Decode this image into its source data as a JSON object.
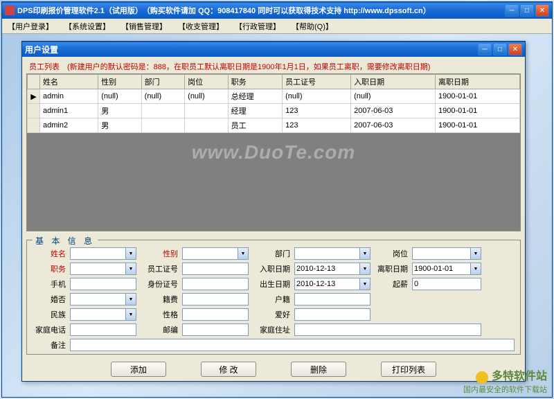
{
  "outer": {
    "title": "DPS印刷报价管理软件2.1（试用版）　（购买软件请加 QQ：908417840 同时可以获取得技术支持 http://www.dpssoft.cn）"
  },
  "menu": [
    "【用户登录】",
    "【系统设置】",
    "【销售管理】",
    "【收支管理】",
    "【行政管理】",
    "【帮助(Q)】"
  ],
  "inner": {
    "title": "用户设置"
  },
  "hint": "员工列表　(新建用户的默认密码是：888，在职员工默认离职日期是1900年1月1日，如果员工离职，需要修改离职日期)",
  "headers": [
    "",
    "姓名",
    "性别",
    "部门",
    "岗位",
    "职务",
    "员工证号",
    "入职日期",
    "离职日期"
  ],
  "rows": [
    {
      "mark": "▶",
      "name": "admin",
      "sex": "(null)",
      "dept": "(null)",
      "post": "(null)",
      "duty": "总经理",
      "eid": "(null)",
      "hire": "(null)",
      "leave": "1900-01-01"
    },
    {
      "mark": "",
      "name": "admin1",
      "sex": "男",
      "dept": "",
      "post": "",
      "duty": "经理",
      "eid": "123",
      "hire": "2007-06-03",
      "leave": "1900-01-01"
    },
    {
      "mark": "",
      "name": "admin2",
      "sex": "男",
      "dept": "",
      "post": "",
      "duty": "员工",
      "eid": "123",
      "hire": "2007-06-03",
      "leave": "1900-01-01"
    }
  ],
  "watermark": "www.DuoTe.com",
  "section_title": "基 本 信 息",
  "labels": {
    "name": "姓名",
    "sex": "性别",
    "dept": "部门",
    "post": "岗位",
    "duty": "职务",
    "eid": "员工证号",
    "hire": "入职日期",
    "leave": "离职日期",
    "mobile": "手机",
    "idcard": "身份证号",
    "birth": "出生日期",
    "origin": "起薪",
    "marriage": "婚否",
    "native_fee": "籍费",
    "hukou": "户籍",
    "nation": "民族",
    "character": "性格",
    "hobby": "爱好",
    "homephone": "家庭电话",
    "zip": "邮编",
    "homeaddr": "家庭住址",
    "remark": "备注"
  },
  "values": {
    "hire": "2010-12-13",
    "leave": "1900-01-01",
    "birth": "2010-12-13",
    "origin": "0"
  },
  "buttons": {
    "add": "添加",
    "edit": "修 改",
    "del": "删除",
    "print": "打印列表"
  },
  "footer": {
    "brand": "多特软件站",
    "slogan": "国内最安全的软件下载站"
  }
}
